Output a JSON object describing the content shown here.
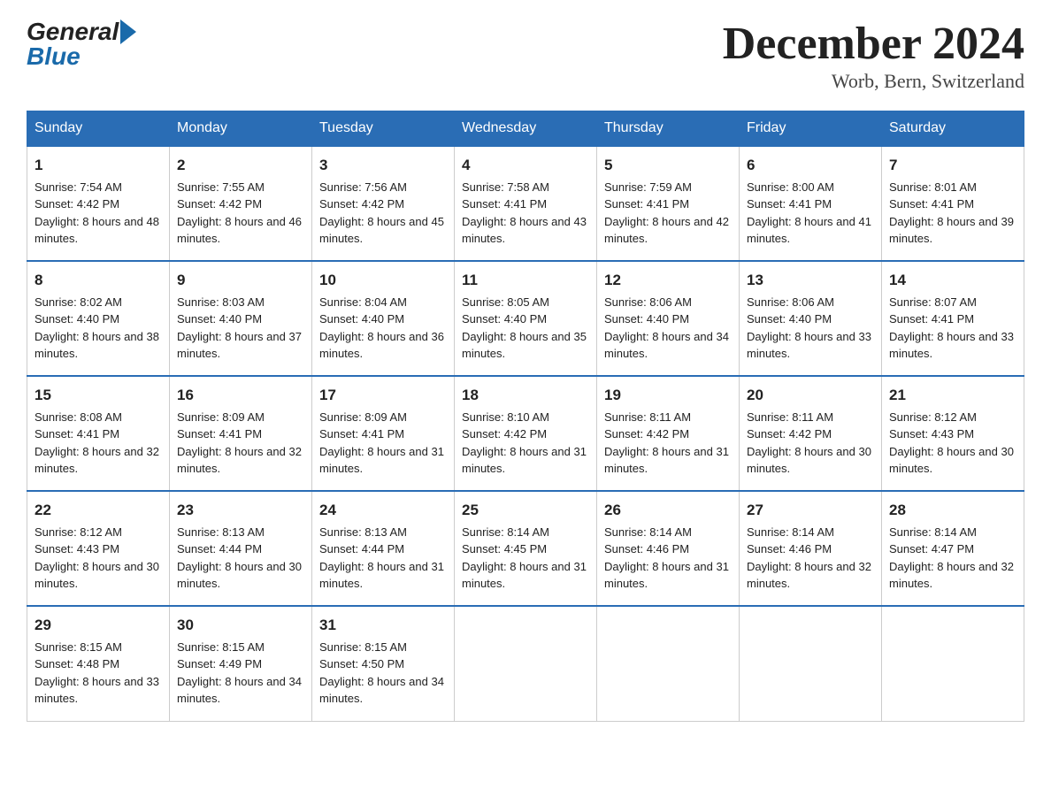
{
  "logo": {
    "general": "General",
    "blue": "Blue"
  },
  "title": "December 2024",
  "location": "Worb, Bern, Switzerland",
  "days_of_week": [
    "Sunday",
    "Monday",
    "Tuesday",
    "Wednesday",
    "Thursday",
    "Friday",
    "Saturday"
  ],
  "weeks": [
    [
      {
        "day": "1",
        "sunrise": "7:54 AM",
        "sunset": "4:42 PM",
        "daylight": "8 hours and 48 minutes."
      },
      {
        "day": "2",
        "sunrise": "7:55 AM",
        "sunset": "4:42 PM",
        "daylight": "8 hours and 46 minutes."
      },
      {
        "day": "3",
        "sunrise": "7:56 AM",
        "sunset": "4:42 PM",
        "daylight": "8 hours and 45 minutes."
      },
      {
        "day": "4",
        "sunrise": "7:58 AM",
        "sunset": "4:41 PM",
        "daylight": "8 hours and 43 minutes."
      },
      {
        "day": "5",
        "sunrise": "7:59 AM",
        "sunset": "4:41 PM",
        "daylight": "8 hours and 42 minutes."
      },
      {
        "day": "6",
        "sunrise": "8:00 AM",
        "sunset": "4:41 PM",
        "daylight": "8 hours and 41 minutes."
      },
      {
        "day": "7",
        "sunrise": "8:01 AM",
        "sunset": "4:41 PM",
        "daylight": "8 hours and 39 minutes."
      }
    ],
    [
      {
        "day": "8",
        "sunrise": "8:02 AM",
        "sunset": "4:40 PM",
        "daylight": "8 hours and 38 minutes."
      },
      {
        "day": "9",
        "sunrise": "8:03 AM",
        "sunset": "4:40 PM",
        "daylight": "8 hours and 37 minutes."
      },
      {
        "day": "10",
        "sunrise": "8:04 AM",
        "sunset": "4:40 PM",
        "daylight": "8 hours and 36 minutes."
      },
      {
        "day": "11",
        "sunrise": "8:05 AM",
        "sunset": "4:40 PM",
        "daylight": "8 hours and 35 minutes."
      },
      {
        "day": "12",
        "sunrise": "8:06 AM",
        "sunset": "4:40 PM",
        "daylight": "8 hours and 34 minutes."
      },
      {
        "day": "13",
        "sunrise": "8:06 AM",
        "sunset": "4:40 PM",
        "daylight": "8 hours and 33 minutes."
      },
      {
        "day": "14",
        "sunrise": "8:07 AM",
        "sunset": "4:41 PM",
        "daylight": "8 hours and 33 minutes."
      }
    ],
    [
      {
        "day": "15",
        "sunrise": "8:08 AM",
        "sunset": "4:41 PM",
        "daylight": "8 hours and 32 minutes."
      },
      {
        "day": "16",
        "sunrise": "8:09 AM",
        "sunset": "4:41 PM",
        "daylight": "8 hours and 32 minutes."
      },
      {
        "day": "17",
        "sunrise": "8:09 AM",
        "sunset": "4:41 PM",
        "daylight": "8 hours and 31 minutes."
      },
      {
        "day": "18",
        "sunrise": "8:10 AM",
        "sunset": "4:42 PM",
        "daylight": "8 hours and 31 minutes."
      },
      {
        "day": "19",
        "sunrise": "8:11 AM",
        "sunset": "4:42 PM",
        "daylight": "8 hours and 31 minutes."
      },
      {
        "day": "20",
        "sunrise": "8:11 AM",
        "sunset": "4:42 PM",
        "daylight": "8 hours and 30 minutes."
      },
      {
        "day": "21",
        "sunrise": "8:12 AM",
        "sunset": "4:43 PM",
        "daylight": "8 hours and 30 minutes."
      }
    ],
    [
      {
        "day": "22",
        "sunrise": "8:12 AM",
        "sunset": "4:43 PM",
        "daylight": "8 hours and 30 minutes."
      },
      {
        "day": "23",
        "sunrise": "8:13 AM",
        "sunset": "4:44 PM",
        "daylight": "8 hours and 30 minutes."
      },
      {
        "day": "24",
        "sunrise": "8:13 AM",
        "sunset": "4:44 PM",
        "daylight": "8 hours and 31 minutes."
      },
      {
        "day": "25",
        "sunrise": "8:14 AM",
        "sunset": "4:45 PM",
        "daylight": "8 hours and 31 minutes."
      },
      {
        "day": "26",
        "sunrise": "8:14 AM",
        "sunset": "4:46 PM",
        "daylight": "8 hours and 31 minutes."
      },
      {
        "day": "27",
        "sunrise": "8:14 AM",
        "sunset": "4:46 PM",
        "daylight": "8 hours and 32 minutes."
      },
      {
        "day": "28",
        "sunrise": "8:14 AM",
        "sunset": "4:47 PM",
        "daylight": "8 hours and 32 minutes."
      }
    ],
    [
      {
        "day": "29",
        "sunrise": "8:15 AM",
        "sunset": "4:48 PM",
        "daylight": "8 hours and 33 minutes."
      },
      {
        "day": "30",
        "sunrise": "8:15 AM",
        "sunset": "4:49 PM",
        "daylight": "8 hours and 34 minutes."
      },
      {
        "day": "31",
        "sunrise": "8:15 AM",
        "sunset": "4:50 PM",
        "daylight": "8 hours and 34 minutes."
      },
      null,
      null,
      null,
      null
    ]
  ],
  "labels": {
    "sunrise": "Sunrise:",
    "sunset": "Sunset:",
    "daylight": "Daylight:"
  }
}
